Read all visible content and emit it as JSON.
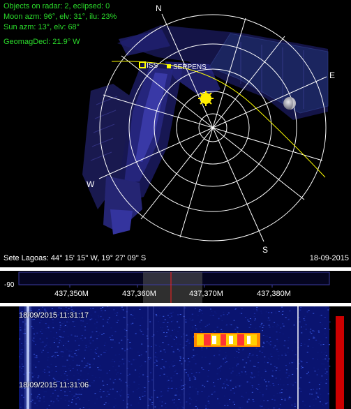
{
  "radar": {
    "info": {
      "objects": "Objects on radar: 2, eclipsed: 0",
      "moon": "Moon azm: 96°, elv: 31°, ilu: 23%",
      "sun": "Sun azm: 13°, elv: 68°",
      "geomag": "GeomagDecl: 21.9° W"
    },
    "directions": {
      "n": "N",
      "e": "E",
      "s": "S",
      "w": "W"
    },
    "objects": [
      {
        "label": "ISS",
        "color": "#ffff00"
      },
      {
        "label": "SERPENS",
        "color": "#ffff00"
      }
    ],
    "location": "Sete Lagoas: 44° 15' 15'' W, 19° 27' 09'' S",
    "date": "18-09-2015",
    "colors": {
      "grid": "#ffffff",
      "track": "#ffff00",
      "sun": "#ffee00",
      "text_green": "#2bdc2b"
    }
  },
  "frequency_bar": {
    "level": "-90",
    "ticks": [
      "437,350M",
      "437,360M",
      "437,370M",
      "437,380M"
    ],
    "colors": {
      "background": "#050520",
      "axis": "#3a3aa0",
      "marker": "#ff2020",
      "highlight": "#555555"
    }
  },
  "waterfall": {
    "timestamps": [
      "18/09/2015 11:31:17",
      "18/09/2015 11:31:06"
    ],
    "colors": {
      "background": "#0a1470",
      "signal": "#ffd000",
      "level_bar": "#cc0000"
    }
  }
}
